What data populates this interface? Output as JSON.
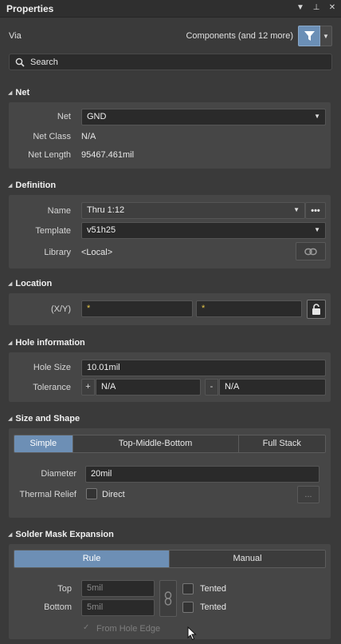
{
  "panel": {
    "title": "Properties",
    "title_icons": [
      "dropdown-arrow-icon",
      "pin-icon",
      "close-icon"
    ]
  },
  "header": {
    "object_type": "Via",
    "filter_text": "Components (and 12 more)",
    "accent": "#6b8fb6"
  },
  "search": {
    "placeholder": "Search"
  },
  "net": {
    "title": "Net",
    "net_label": "Net",
    "net_value": "GND",
    "netclass_label": "Net Class",
    "netclass_value": "N/A",
    "netlength_label": "Net Length",
    "netlength_value": "95467.461mil"
  },
  "definition": {
    "title": "Definition",
    "name_label": "Name",
    "name_value": "Thru 1:12",
    "template_label": "Template",
    "template_value": "v51h25",
    "library_label": "Library",
    "library_value": "<Local>"
  },
  "location": {
    "title": "Location",
    "xy_label": "(X/Y)",
    "x_value": "*",
    "y_value": "*"
  },
  "hole": {
    "title": "Hole information",
    "size_label": "Hole Size",
    "size_value": "10.01mil",
    "tol_label": "Tolerance",
    "plus": "+",
    "minus": "-",
    "tol_plus_value": "N/A",
    "tol_minus_value": "N/A"
  },
  "size_shape": {
    "title": "Size and Shape",
    "modes": [
      "Simple",
      "Top-Middle-Bottom",
      "Full Stack"
    ],
    "selected_mode": "Simple",
    "diameter_label": "Diameter",
    "diameter_value": "20mil",
    "thermal_label": "Thermal Relief",
    "thermal_option": "Direct",
    "more_button": "..."
  },
  "solder_mask": {
    "title": "Solder Mask Expansion",
    "modes": [
      "Rule",
      "Manual"
    ],
    "selected_mode": "Rule",
    "top_label": "Top",
    "top_value": "5mil",
    "bottom_label": "Bottom",
    "bottom_value": "5mil",
    "top_tented": "Tented",
    "bottom_tented": "Tented",
    "from_hole_edge": "From Hole Edge"
  }
}
